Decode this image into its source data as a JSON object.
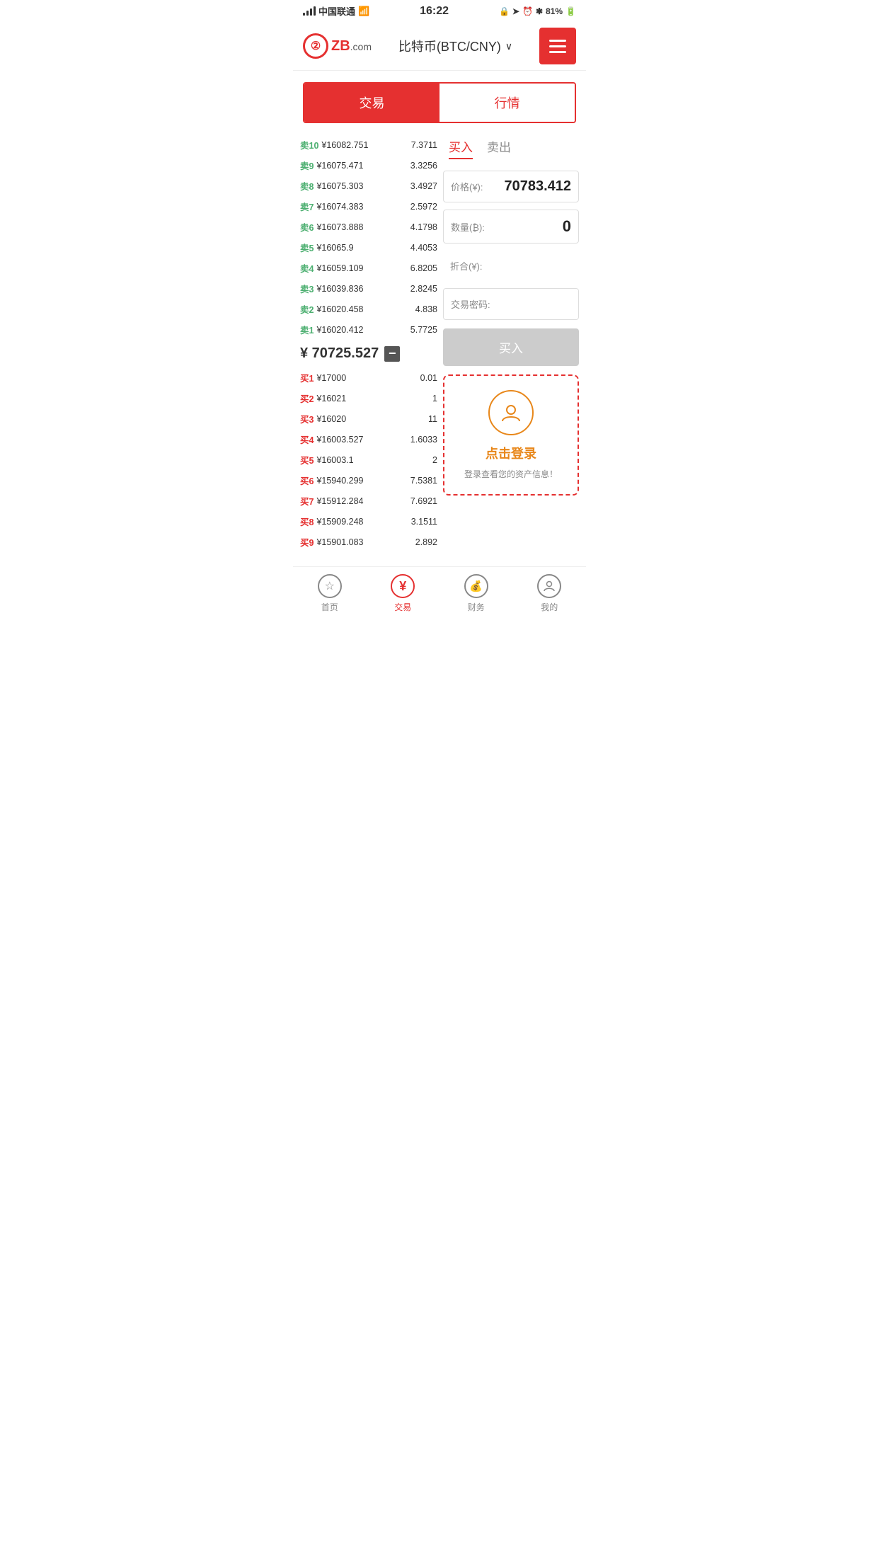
{
  "statusBar": {
    "carrier": "中国联通",
    "time": "16:22",
    "battery": "81%"
  },
  "header": {
    "title": "比特币(BTC/CNY)",
    "logoText": "ZB",
    "logoSub": ".com"
  },
  "tabs": {
    "left": "交易",
    "right": "行情"
  },
  "buySell": {
    "buy": "买入",
    "sell": "卖出"
  },
  "tradeForm": {
    "priceLabel": "价格(¥):",
    "priceValue": "70783.412",
    "qtyLabel": "数量(₿):",
    "qtyValue": "0",
    "zheLabel": "折合(¥):",
    "pwLabel": "交易密码:",
    "buyBtnLabel": "买入"
  },
  "orderBook": {
    "sells": [
      {
        "label": "卖10",
        "price": "¥16082.751",
        "qty": "7.3711"
      },
      {
        "label": "卖9",
        "price": "¥16075.471",
        "qty": "3.3256"
      },
      {
        "label": "卖8",
        "price": "¥16075.303",
        "qty": "3.4927"
      },
      {
        "label": "卖7",
        "price": "¥16074.383",
        "qty": "2.5972"
      },
      {
        "label": "卖6",
        "price": "¥16073.888",
        "qty": "4.1798"
      },
      {
        "label": "卖5",
        "price": "¥16065.9",
        "qty": "4.4053"
      },
      {
        "label": "卖4",
        "price": "¥16059.109",
        "qty": "6.8205"
      },
      {
        "label": "卖3",
        "price": "¥16039.836",
        "qty": "2.8245"
      },
      {
        "label": "卖2",
        "price": "¥16020.458",
        "qty": "4.838"
      },
      {
        "label": "卖1",
        "price": "¥16020.412",
        "qty": "5.7725"
      }
    ],
    "midPrice": "¥ 70725.527",
    "buys": [
      {
        "label": "买1",
        "price": "¥17000",
        "qty": "0.01"
      },
      {
        "label": "买2",
        "price": "¥16021",
        "qty": "1"
      },
      {
        "label": "买3",
        "price": "¥16020",
        "qty": "11"
      },
      {
        "label": "买4",
        "price": "¥16003.527",
        "qty": "1.6033"
      },
      {
        "label": "买5",
        "price": "¥16003.1",
        "qty": "2"
      },
      {
        "label": "买6",
        "price": "¥15940.299",
        "qty": "7.5381"
      },
      {
        "label": "买7",
        "price": "¥15912.284",
        "qty": "7.6921"
      },
      {
        "label": "买8",
        "price": "¥15909.248",
        "qty": "3.1511"
      },
      {
        "label": "买9",
        "price": "¥15901.083",
        "qty": "2.892"
      }
    ]
  },
  "loginBox": {
    "btnText": "点击登录",
    "subText": "登录查看您的资产信息！"
  },
  "bottomNav": [
    {
      "label": "首页",
      "icon": "★",
      "active": false
    },
    {
      "label": "交易",
      "icon": "¥",
      "active": true
    },
    {
      "label": "财务",
      "icon": "💰",
      "active": false
    },
    {
      "label": "我的",
      "icon": "👤",
      "active": false
    }
  ]
}
